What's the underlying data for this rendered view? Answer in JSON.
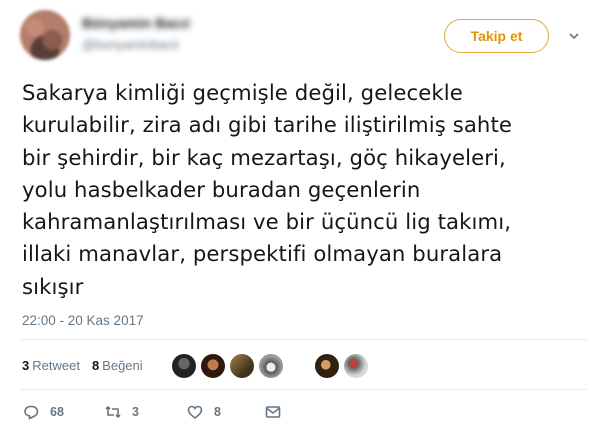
{
  "user": {
    "display_name": "Bünyamin Bacıi",
    "handle": "@bunyaminbacii"
  },
  "header": {
    "follow_label": "Takip et"
  },
  "tweet": {
    "lines": [
      "Sakarya kimliği geçmişle değil, gelecekle",
      "kurulabilir, zira adı gibi tarihe iliştirilmiş sahte",
      "bir şehirdir, bir kaç mezartaşı, göç hikayeleri,",
      "yolu hasbelkader buradan geçenlerin",
      "kahramanlaştırılması ve bir üçüncü lig takımı,",
      "illaki manavlar, perspektifi olmayan buralara",
      "sıkışır"
    ],
    "timestamp": "22:00 - 20 Kas 2017"
  },
  "stats": {
    "retweet_count": "3",
    "retweet_label": "Retweet",
    "like_count": "8",
    "like_label": "Beğeni"
  },
  "actions": {
    "reply_count": "68",
    "retweet_count": "3",
    "like_count": "8"
  },
  "colors": {
    "accent": "#e5920c",
    "muted": "#657786",
    "text": "#14171a"
  }
}
